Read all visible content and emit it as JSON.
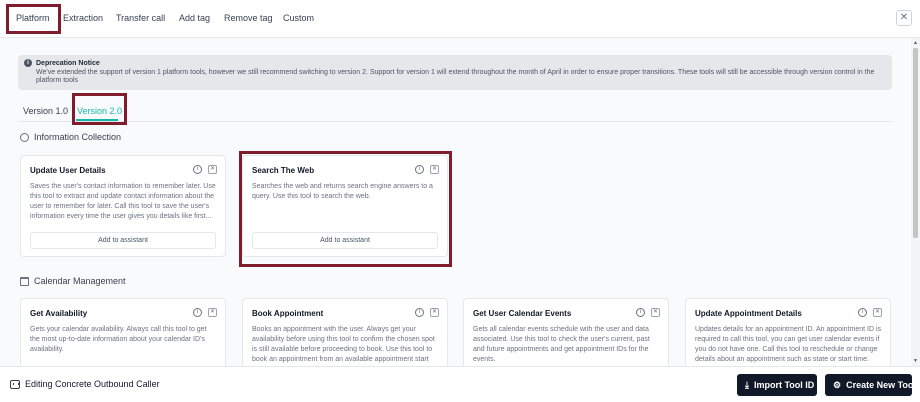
{
  "tabs": [
    {
      "label": "Platform"
    },
    {
      "label": "Extraction"
    },
    {
      "label": "Transfer call"
    },
    {
      "label": "Add tag"
    },
    {
      "label": "Remove tag"
    },
    {
      "label": "Custom"
    }
  ],
  "notice": {
    "title": "Deprecation Notice",
    "body": "We've extended the support of version 1 platform tools, however we still recommend switching to version 2. Support for version 1 will extend throughout the month of April in order to ensure proper transitions. These tools will still be accessible through version control in the platform tools"
  },
  "versions": [
    {
      "label": "Version 1.0"
    },
    {
      "label": "Version 2.0"
    }
  ],
  "sections": {
    "info": {
      "title": "Information Collection",
      "cards": [
        {
          "title": "Update User Details",
          "desc": "Saves the user's contact information to remember later. Use this tool to extract and update contact information about the user to remember for later. Call this tool to save the user's information every time the user gives you details like first...",
          "button": "Add to assistant"
        },
        {
          "title": "Search The Web",
          "desc": "Searches the web and returns search engine answers to a query. Use this tool to search the web.",
          "button": "Add to assistant"
        }
      ]
    },
    "calendar": {
      "title": "Calendar Management",
      "cards": [
        {
          "title": "Get Availability",
          "desc": "Gets your calendar availability. Always call this tool to get the most up-to-date information about your calendar ID's availability."
        },
        {
          "title": "Book Appointment",
          "desc": "Books an appointment with the user. Always get your availability before using this tool to confirm the chosen spot is still available before proceeding to book. Use this tool to book an appointment from an available appointment start times..."
        },
        {
          "title": "Get User Calendar Events",
          "desc": "Gets all calendar events schedule with the user and data associated. Use this tool to check the user's current, past and future appointments and get appointment IDs for the events."
        },
        {
          "title": "Update Appointment Details",
          "desc": "Updates details for an appointment ID. An appointment ID is required to call this tool, you can get user calendar events if you do not have one. Call this tool to reschedule or change details about an appointment such as state or start time."
        }
      ]
    }
  },
  "footer": {
    "editing": "Editing Concrete Outbound Caller",
    "import_label": "Import Tool ID",
    "create_label": "Create New Tool"
  },
  "colors": {
    "accent": "#14b8a6",
    "highlight": "#7f1d2d",
    "button_dark": "#111827"
  }
}
